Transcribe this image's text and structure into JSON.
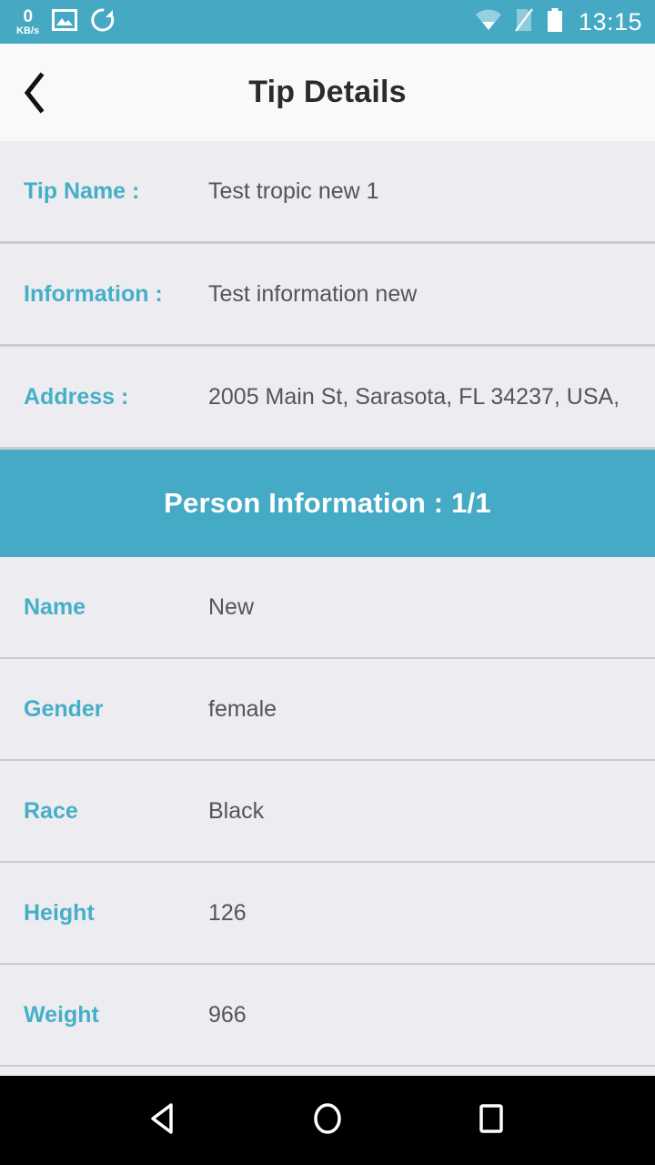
{
  "status_bar": {
    "network_speed_value": "0",
    "network_speed_unit": "KB/s",
    "gallery_icon": "image-icon",
    "sync_icon": "sync-icon",
    "wifi_icon": "wifi-icon",
    "sim_icon": "sim-card-disabled-icon",
    "battery_icon": "battery-icon",
    "time": "13:15",
    "background_color": "#45A9C4"
  },
  "app_bar": {
    "back_icon": "back-chevron-icon",
    "title": "Tip Details",
    "background_color": "#F9F9F9"
  },
  "details": {
    "rows": [
      {
        "label": "Tip Name :",
        "value": "Test tropic new 1"
      },
      {
        "label": "Information :",
        "value": "Test information new"
      },
      {
        "label": "Address :",
        "value": "2005 Main St, Sarasota, FL 34237, USA,"
      }
    ]
  },
  "person_section": {
    "band_title": "Person Information : 1/1",
    "band_color": "#45AAC5",
    "rows": [
      {
        "label": "Name",
        "value": "New"
      },
      {
        "label": "Gender",
        "value": "female"
      },
      {
        "label": "Race",
        "value": "Black"
      },
      {
        "label": "Height",
        "value": "126"
      },
      {
        "label": "Weight",
        "value": "966"
      }
    ]
  },
  "nav_bar": {
    "back_icon": "triangle-back-icon",
    "home_icon": "circle-home-icon",
    "recents_icon": "square-recents-icon",
    "background_color": "#000000"
  },
  "theme": {
    "accent": "#45AFC8",
    "row_background": "#EDECF1",
    "divider": "#CCCBD1",
    "value_text": "#555558"
  }
}
